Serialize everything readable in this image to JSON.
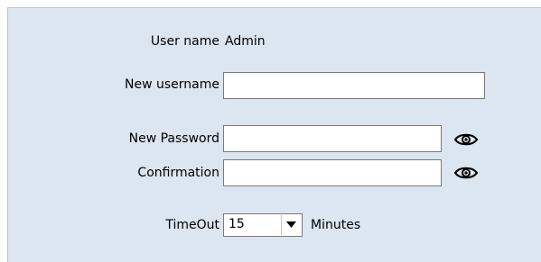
{
  "form": {
    "username_label": "User name",
    "username_value": "Admin",
    "new_username_label": "New username",
    "new_username_value": "",
    "new_password_label": "New Password",
    "new_password_value": "",
    "confirmation_label": "Confirmation",
    "confirmation_value": "",
    "timeout_label": "TimeOut",
    "timeout_value": "15",
    "timeout_unit": "Minutes"
  },
  "icons": {
    "show_password": "eye-icon",
    "show_confirmation": "eye-icon",
    "dropdown": "chevron-down-icon"
  },
  "colors": {
    "panel_background": "#dce6f1",
    "field_background": "#ffffff",
    "field_border": "#7a7a7a"
  }
}
